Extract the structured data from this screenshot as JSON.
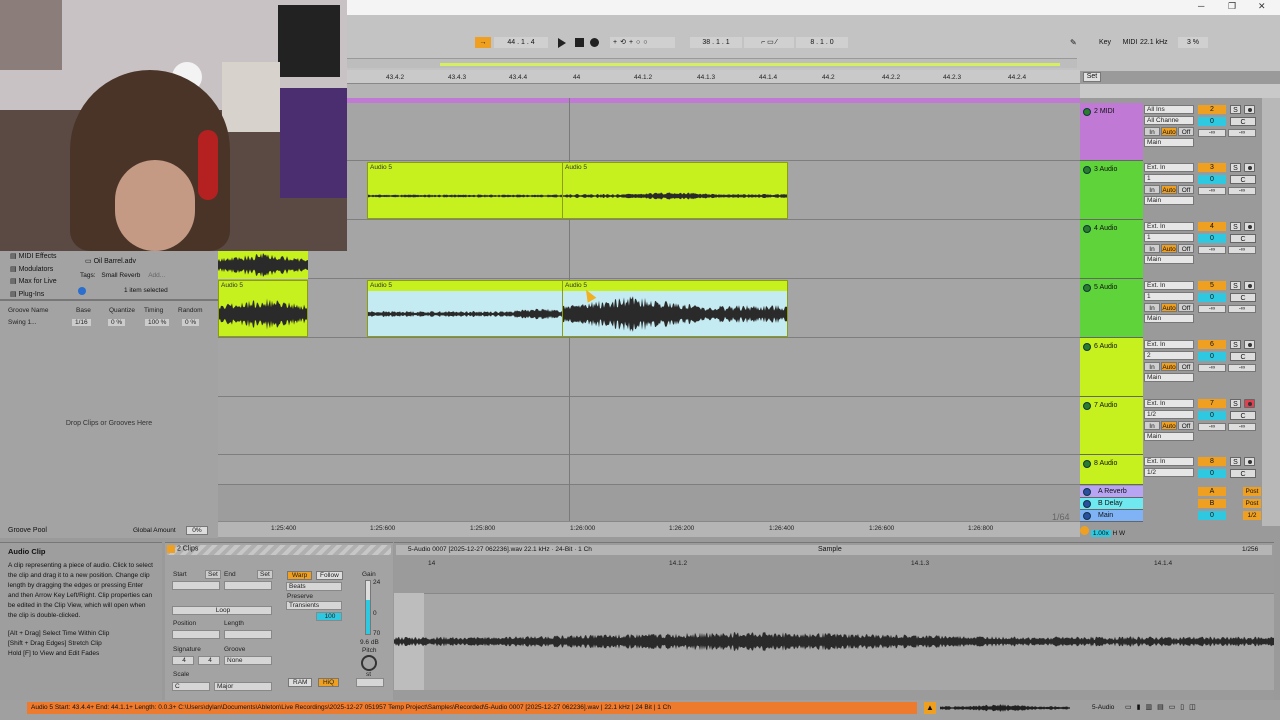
{
  "transport": {
    "position": "44 . 1 . 4",
    "loop_start": "38 . 1 . 1",
    "loop_length": "8 . 1 . 0",
    "key_label": "Key",
    "midi_label": "MIDI",
    "sample_rate": "22.1 kHz",
    "cpu": "3 %",
    "set_label": "Set"
  },
  "ruler": [
    "43.4.2",
    "43.4.3",
    "43.4.4",
    "44",
    "44.1.2",
    "44.1.3",
    "44.1.4",
    "44.2",
    "44.2.2",
    "44.2.3",
    "44.2.4"
  ],
  "time_ruler": [
    "1:25:400",
    "1:25:600",
    "1:25:800",
    "1:26:000",
    "1:26:200",
    "1:26:400",
    "1:26:600",
    "1:26:800"
  ],
  "zoom_label": "1/64",
  "tracks": [
    {
      "name": "2 MIDI",
      "color": "#c07ad6",
      "input": "All Ins",
      "channel": "All Channe",
      "out": "Main",
      "num": "2",
      "vol": "0",
      "pan": "C"
    },
    {
      "name": "3 Audio",
      "color": "#5ed43a",
      "input": "Ext. In",
      "channel": "1",
      "out": "Main",
      "num": "3",
      "vol": "0",
      "pan": "C"
    },
    {
      "name": "4 Audio",
      "color": "#5ed43a",
      "input": "Ext. In",
      "channel": "1",
      "out": "Main",
      "num": "4",
      "vol": "0",
      "pan": "C"
    },
    {
      "name": "5 Audio",
      "color": "#5ed43a",
      "input": "Ext. In",
      "channel": "1",
      "out": "Main",
      "num": "5",
      "vol": "0",
      "pan": "C"
    },
    {
      "name": "6 Audio",
      "color": "#c6f01e",
      "input": "Ext. In",
      "channel": "2",
      "out": "Main",
      "num": "6",
      "vol": "0",
      "pan": "C"
    },
    {
      "name": "7 Audio",
      "color": "#c6f01e",
      "input": "Ext. In",
      "channel": "1/2",
      "out": "Main",
      "num": "7",
      "vol": "0",
      "pan": "C"
    },
    {
      "name": "8 Audio",
      "color": "#c6f01e",
      "input": "Ext. In",
      "channel": "1/2",
      "out": "Main",
      "num": "8",
      "vol": "0",
      "pan": "C"
    }
  ],
  "returns": [
    {
      "name": "A Reverb",
      "color": "#b7a4f2",
      "letter": "A",
      "label": "Post"
    },
    {
      "name": "B Delay",
      "color": "#6fe8f0",
      "letter": "B",
      "label": "Post"
    },
    {
      "name": "Main",
      "color": "#7fb3f5",
      "letter": "0",
      "label": "1/2"
    }
  ],
  "monitor": {
    "in": "In",
    "auto": "Auto",
    "off": "Off"
  },
  "clips": {
    "track3_a": "Audio 5",
    "track3_b": "Audio 5",
    "track5_a": "Audio 5",
    "track5_b": "Audio 5",
    "track5_c": "Audio 5"
  },
  "browser": {
    "items": [
      "MIDI Effects",
      "Modulators",
      "Max for Live",
      "Plug-Ins"
    ],
    "file": "Oil Barrel.adv",
    "tags_label": "Tags:",
    "tag": "Small Reverb",
    "add": "Add...",
    "selected": "1 item selected"
  },
  "groove": {
    "headers": [
      "Groove Name",
      "Base",
      "Quantize",
      "Timing",
      "Random"
    ],
    "row": {
      "name": "Swing 1...",
      "base": "1/16",
      "quantize": "0 %",
      "timing": "100 %",
      "random": "0 %"
    },
    "drop": "Drop Clips or Grooves Here",
    "pool": "Groove Pool",
    "global_label": "Global Amount",
    "global_value": "0%"
  },
  "info": {
    "title": "Audio Clip",
    "body": "A clip representing a piece of audio. Click to select the clip and drag it to a new position. Change clip length by dragging the edges or pressing Enter and then Arrow Key Left/Right. Clip properties can be edited in the Clip View, which will open when the clip is double-clicked.",
    "hints": [
      "[Alt + Drag] Select Time Within Clip",
      "[Shift + Drag Edges] Stretch Clip",
      "Hold [F] to View and Edit Fades"
    ]
  },
  "clipview": {
    "tab": "2 Clips",
    "start": "Start",
    "end": "End",
    "set": "Set",
    "loop": "Loop",
    "position": "Position",
    "length": "Length",
    "signature": "Signature",
    "sig_num": "4",
    "sig_den": "4",
    "groove": "Groove",
    "groove_val": "None",
    "scale": "Scale",
    "scale_root": "C",
    "scale_mode": "Major",
    "warp": "Warp",
    "follow": "Follow",
    "beats": "Beats",
    "preserve": "Preserve",
    "transients": "Transients",
    "warp_amount": "100",
    "gain": "Gain",
    "gain_db": "9.6 dB",
    "pitch": "Pitch",
    "st": "st",
    "ram": "RAM",
    "hiq": "HiQ",
    "gain_top": "24",
    "gain_mid": "0",
    "gain_low": "70"
  },
  "sample": {
    "file": "5-Audio 0007 [2025-12-27 062236].wav  22.1 kHz · 24-Bit · 1 Ch",
    "tab": "Sample",
    "zoom": "1/256",
    "ruler": [
      "14",
      "14.1.2",
      "14.1.3",
      "14.1.4"
    ]
  },
  "status": "Audio 5  Start: 43.4.4+  End: 44.1.1+  Length: 0.0.3+  C:\\Users\\dylan\\Documents\\Ableton\\Live Recordings\\2025-12-27 051957 Temp Project\\Samples\\Recorded\\5-Audio 0007 [2025-12-27 062236].wav | 22.1 kHz | 24 Bit | 1 Ch",
  "status_track": "5-Audio",
  "colors": {
    "lime": "#c6f01e",
    "orange": "#ee7a2e",
    "accent": "#f0a020",
    "cyan": "#2ec8e0"
  }
}
